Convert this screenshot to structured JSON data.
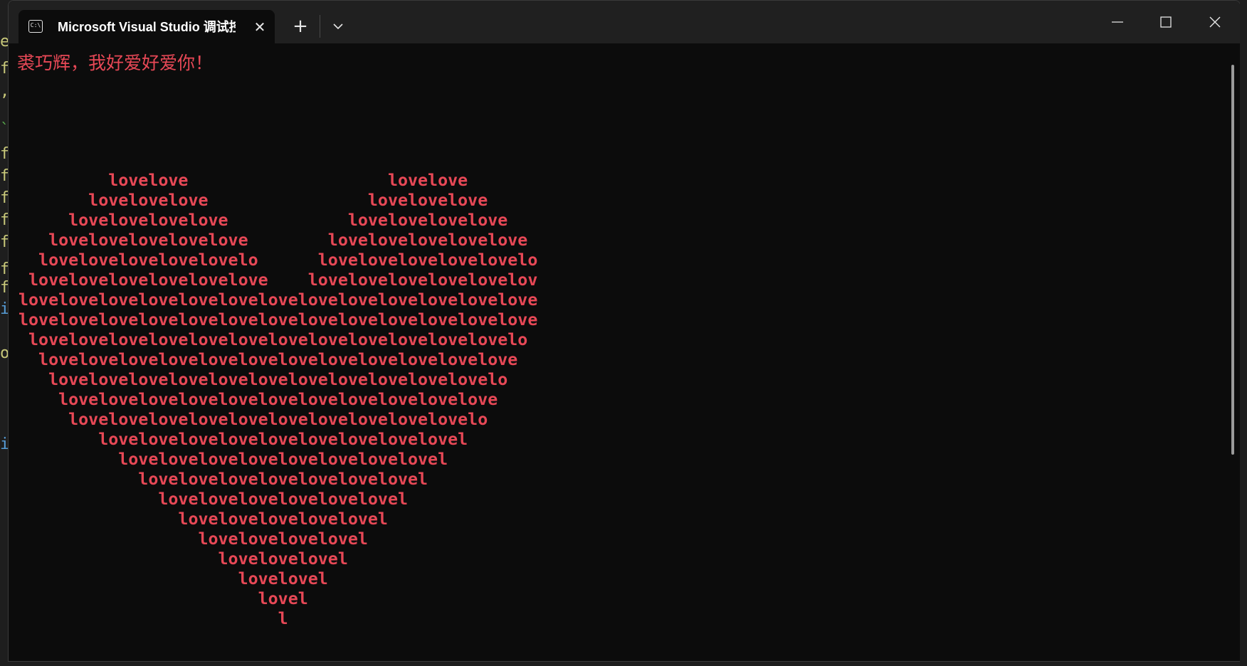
{
  "window": {
    "tab_title": "Microsoft Visual Studio 调试控制台",
    "tab_icon": "console-app-icon",
    "tab_close_label": "✕",
    "new_tab_label": "+",
    "controls": [
      "minimize-icon",
      "maximize-icon",
      "close-icon"
    ]
  },
  "console": {
    "header": "裘巧辉，我好爱好爱你！",
    "text_color": "#e74856",
    "background": "#0c0c0c",
    "heart_lines": [
      "         lovelove                    lovelove",
      "       lovelovelove                lovelovelove",
      "     lovelovelovelove            lovelovelovelove",
      "   lovelovelovelovelove        lovelovelovelovelove",
      "  lovelovelovelovelovelo      lovelovelovelovelovelo",
      " lovelovelovelovelovelove    lovelovelovelovelovelov",
      "lovelovelovelovelovelovelovelovelovelovelovelovelove",
      "lovelovelovelovelovelovelovelovelovelovelovelovelove",
      " lovelovelovelovelovelovelovelovelovelovelovelovelo",
      "  lovelovelovelovelovelovelovelovelovelovelovelove",
      "   lovelovelovelovelovelovelovelovelovelovelovelo",
      "    lovelovelovelovelovelovelovelovelovelovelove",
      "     lovelovelovelovelovelovelovelovelovelovelo",
      "        lovelovelovelovelovelovelovelovelovel",
      "          lovelovelovelovelovelovelovelovel",
      "            lovelovelovelovelovelovelovel",
      "              lovelovelovelovelovelovel",
      "                lovelovelovelovelovel",
      "                  lovelovelovelovel",
      "                    lovelovelovel",
      "                      lovelovel",
      "                        lovel",
      "                          l"
    ]
  }
}
